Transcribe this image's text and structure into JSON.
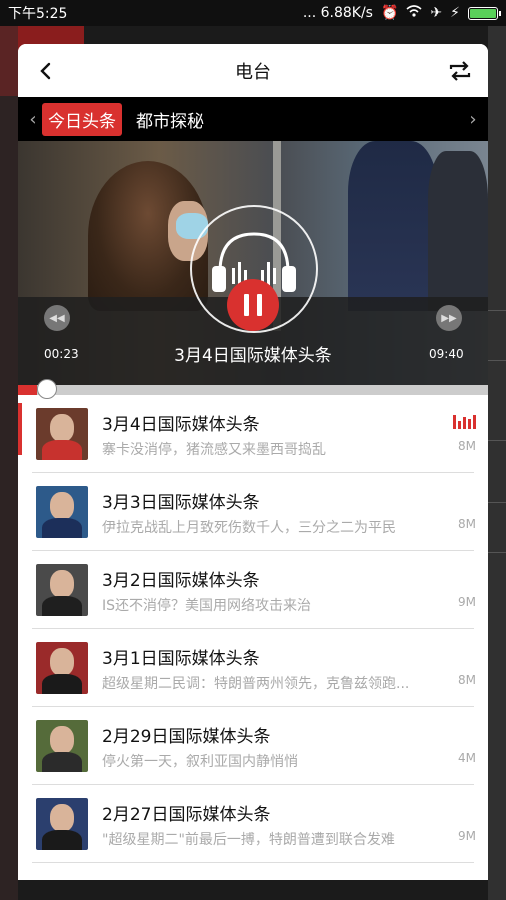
{
  "status_bar": {
    "time": "下午5:25",
    "network_speed": "... 6.88K/s"
  },
  "header": {
    "title": "电台"
  },
  "tabs": [
    {
      "label": "今日头条",
      "active": true
    },
    {
      "label": "都市探秘",
      "active": false
    }
  ],
  "player": {
    "elapsed": "00:23",
    "duration": "09:40",
    "title": "3月4日国际媒体头条",
    "progress_fraction": 0.04
  },
  "playlist": [
    {
      "title": "3月4日国际媒体头条",
      "subtitle": "寨卡没消停，猪流感又来墨西哥捣乱",
      "size": "8M",
      "playing": true,
      "thumb_bg": "#6b3b2c",
      "thumb_body": "#c7322e"
    },
    {
      "title": "3月3日国际媒体头条",
      "subtitle": "伊拉克战乱上月致死伤数千人，三分之二为平民",
      "size": "8M",
      "playing": false,
      "thumb_bg": "#2d5a8a",
      "thumb_body": "#1c2f5a"
    },
    {
      "title": "3月2日国际媒体头条",
      "subtitle": "IS还不消停？美国用网络攻击来治",
      "size": "9M",
      "playing": false,
      "thumb_bg": "#4a4a4a",
      "thumb_body": "#1f1f1f"
    },
    {
      "title": "3月1日国际媒体头条",
      "subtitle": "超级星期二民调：特朗普两州领先，克鲁兹领跑...",
      "size": "8M",
      "playing": false,
      "thumb_bg": "#9a2a2a",
      "thumb_body": "#1a1a1a"
    },
    {
      "title": "2月29日国际媒体头条",
      "subtitle": "停火第一天，叙利亚国内静悄悄",
      "size": "4M",
      "playing": false,
      "thumb_bg": "#556b3a",
      "thumb_body": "#2b2b2b"
    },
    {
      "title": "2月27日国际媒体头条",
      "subtitle": "\"超级星期二\"前最后一搏，特朗普遭到联合发难",
      "size": "9M",
      "playing": false,
      "thumb_bg": "#2b3f6e",
      "thumb_body": "#1a1a1a"
    }
  ],
  "colors": {
    "accent": "#d9312f"
  }
}
